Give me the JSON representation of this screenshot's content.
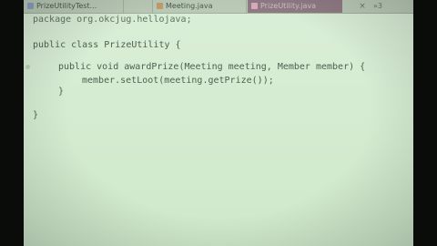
{
  "tabs": [
    {
      "label": "PrizeUtilityTest...",
      "icon": "java-test-file-icon"
    },
    {
      "label": "Meeting.java",
      "icon": "java-class-file-icon"
    },
    {
      "label": "PrizeUtility.java",
      "icon": "java-class-file-icon",
      "active": true
    }
  ],
  "tab_close_glyph": "×",
  "tab_overflow_label": "»3",
  "code": {
    "line1": "package org.okcjug.hellojava;",
    "line2": "public class PrizeUtility {",
    "line3": "public void awardPrize(Meeting meeting, Member member) {",
    "line4_before": "member.setLoot(meeting.getPrize(",
    "line4_paren": ")",
    "line4_after": ");",
    "line5": "}",
    "line6": "}"
  },
  "colors": {
    "editor_bg": "#d6ecd2",
    "tabbar_bg": "#b9c9b6",
    "active_tab_bg": "#8f7a83",
    "code_text": "#4f6150"
  }
}
